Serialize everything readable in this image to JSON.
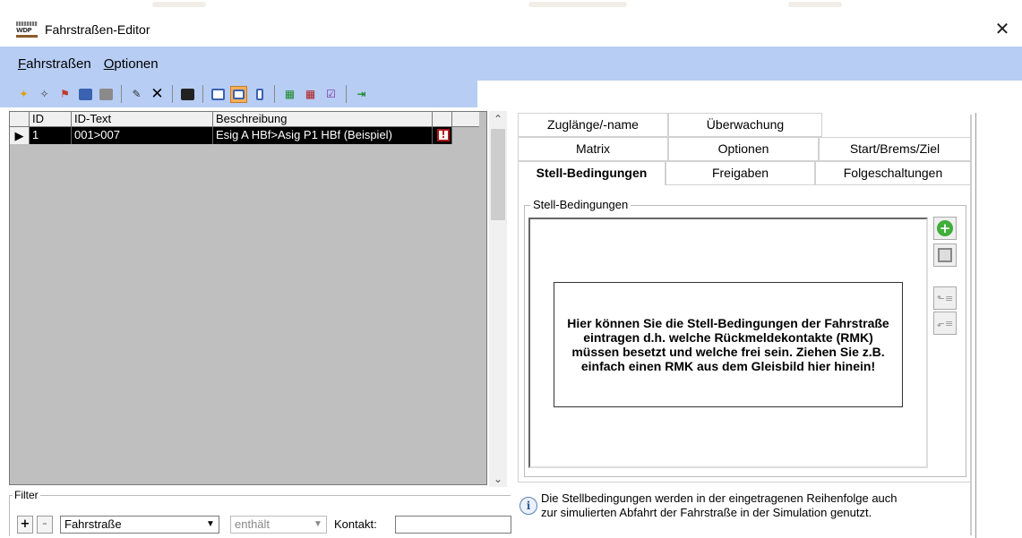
{
  "window": {
    "title": "Fahrstraßen-Editor",
    "app_icon_text": "WDP"
  },
  "menu": [
    {
      "label": "Fahrstraßen"
    },
    {
      "label": "Optionen"
    }
  ],
  "toolbar": {
    "icons": [
      "new-icon",
      "wizard-icon",
      "flag-icon",
      "save-icon",
      "print-icon",
      "rename-icon",
      "delete-icon",
      "block-icon",
      "table-view-icon",
      "matrix-view-icon",
      "column-view-icon",
      "route-green-icon",
      "route-red-icon",
      "check-icon",
      "exit-icon"
    ]
  },
  "grid": {
    "columns": [
      "ID",
      "ID-Text",
      "Beschreibung",
      ""
    ],
    "rows": [
      {
        "id": "1",
        "id_text": "001>007",
        "description": "Esig A HBf>Asig P1 HBf (Beispiel)",
        "warning_glyph": "!"
      }
    ]
  },
  "filter": {
    "legend": "Filter",
    "add_label": "+",
    "remove_label": "-",
    "field_value": "Fahrstraße",
    "operator_value": "enthält",
    "contact_label": "Kontakt:",
    "contact_value": ""
  },
  "tabs": {
    "row1": [
      "Zuglänge/-name",
      "Überwachung"
    ],
    "row2": [
      "Matrix",
      "Optionen",
      "Start/Brems/Ziel"
    ],
    "row3": [
      "Stell-Bedingungen",
      "Freigaben",
      "Folgeschaltungen"
    ],
    "active": "Stell-Bedingungen"
  },
  "stell_bedingungen": {
    "group_label": "Stell-Bedingungen",
    "hint": "Hier können Sie die Stell-Bedingungen der Fahrstraße eintragen d.h. welche Rückmeldekontakte (RMK) müssen besetzt und welche frei sein. Ziehen Sie z.B. einfach einen RMK aus dem Gleisbild hier hinein!",
    "info_text_line1": "Die Stellbedingungen werden in der eingetragenen Reihenfolge auch",
    "info_text_line2": "zur simulierten Abfahrt der Fahrstraße in der Simulation genutzt."
  },
  "colors": {
    "menubar_bg": "#b7cdf4",
    "list_bg": "#bfbfbf",
    "selected_row_bg": "#000000",
    "add_button_green": "#3fae3a"
  }
}
